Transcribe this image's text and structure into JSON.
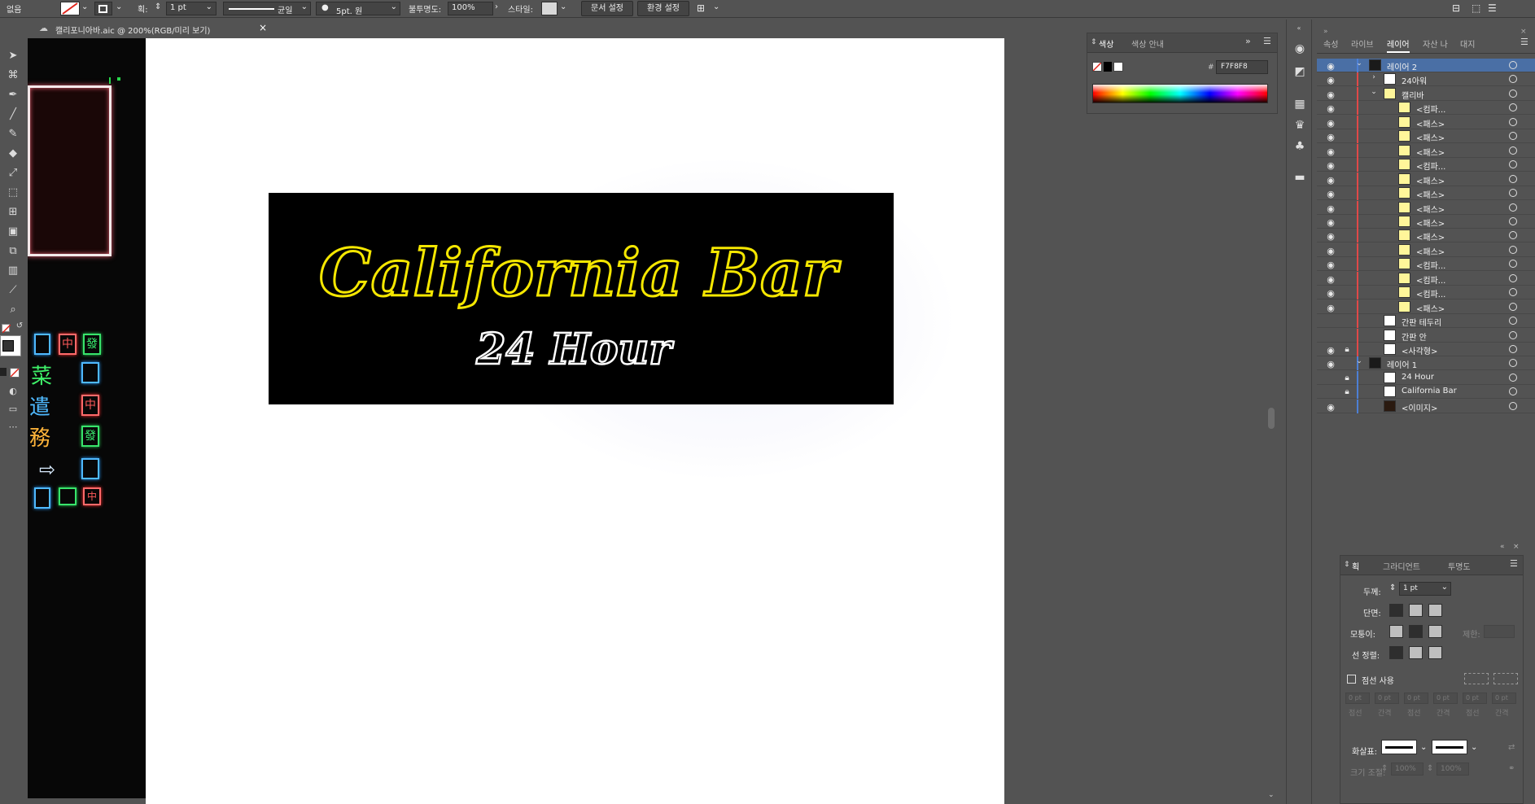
{
  "control_bar": {
    "selection_label": "없음",
    "stroke_label": "획:",
    "stroke_weight": "1 pt",
    "variable_width": "균일",
    "brush": "5pt. 원",
    "opacity_label": "불투명도:",
    "opacity_value": "100%",
    "style_label": "스타일:",
    "doc_setup_button": "문서 설정",
    "preferences_button": "환경 설정"
  },
  "document_tab": {
    "title": "캘리포니아바.aic @ 200%(RGB/미리 보기)",
    "close": "×"
  },
  "artwork": {
    "headline": "California Bar",
    "subline": "24 Hour",
    "headline_color": "#F5E700",
    "subline_color": "#FFFFFF",
    "neon_glyphs": [
      "中",
      "發",
      "菜",
      "遣",
      "務",
      "中",
      "發",
      "中"
    ]
  },
  "color_panel": {
    "tabs": [
      "색상",
      "색상 안내"
    ],
    "hex_label": "#",
    "hex_value": "F7F8F8"
  },
  "layers_panel": {
    "tabs": [
      "속성",
      "라이브",
      "레이어",
      "자산 나",
      "대지"
    ],
    "active_tab": "레이어",
    "rows": [
      {
        "name": "레이어 2",
        "selected": true
      },
      {
        "name": "24아워"
      },
      {
        "name": "캘리바"
      },
      {
        "name": "<컴파..."
      },
      {
        "name": "<패스>"
      },
      {
        "name": "<패스>"
      },
      {
        "name": "<패스>"
      },
      {
        "name": "<컴파..."
      },
      {
        "name": "<패스>"
      },
      {
        "name": "<패스>"
      },
      {
        "name": "<패스>"
      },
      {
        "name": "<패스>"
      },
      {
        "name": "<패스>"
      },
      {
        "name": "<패스>"
      },
      {
        "name": "<컴파..."
      },
      {
        "name": "<컴파..."
      },
      {
        "name": "<컴파..."
      },
      {
        "name": "<패스>"
      },
      {
        "name": "간판 테두리"
      },
      {
        "name": "간판 안"
      },
      {
        "name": "<사각형>"
      },
      {
        "name": "레이어 1"
      },
      {
        "name": "24 Hour"
      },
      {
        "name": "California Bar"
      },
      {
        "name": "<이미지>"
      }
    ]
  },
  "stroke_panel": {
    "tabs": [
      "획",
      "그라디언트",
      "투명도"
    ],
    "weight_label": "두께:",
    "weight_value": "1 pt",
    "cap_label": "단면:",
    "corner_label": "모퉁이:",
    "limit_label": "제한:",
    "align_label": "선 정렬:",
    "dashed_label": "점선 사용",
    "dash_values": [
      "0 pt",
      "0 pt",
      "0 pt",
      "0 pt",
      "0 pt",
      "0 pt"
    ],
    "dash_labels": [
      "점선",
      "간격",
      "점선",
      "간격",
      "점선",
      "간격"
    ],
    "arrow_label": "화살표:",
    "scale_label": "크기 조절:",
    "scale_values": [
      "100%",
      "100%"
    ]
  }
}
